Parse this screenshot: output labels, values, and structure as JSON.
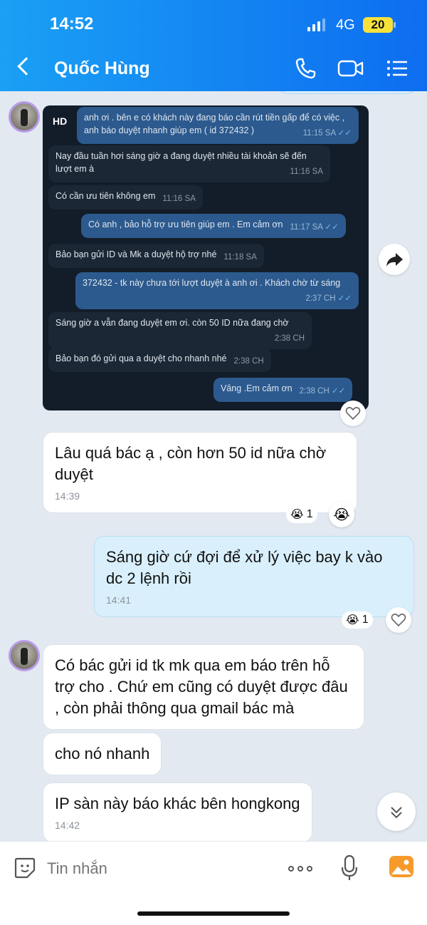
{
  "status_bar": {
    "time": "14:52",
    "network": "4G",
    "battery": "20"
  },
  "header": {
    "contact_name": "Quốc Hùng"
  },
  "image_message": {
    "badge": "HD",
    "messages": [
      {
        "dir": "out",
        "text": "anh ơi . bên e có khách này đang báo cần rút tiền gấp để có việc , anh báo duyệt nhanh giúp em ( id 372432 )",
        "time": "11:15 SA"
      },
      {
        "dir": "in",
        "text": "Nay đầu tuần hơi sáng giờ a đang duyệt nhiều tài khoản sẽ đến lượt em à",
        "time": "11:16 SA"
      },
      {
        "dir": "in",
        "text": "Có cần ưu tiên không em",
        "time": "11:16 SA"
      },
      {
        "dir": "out",
        "text": "Có anh , bảo hỗ trợ ưu tiên giúp em . Em cảm ơn",
        "time": "11:17 SA"
      },
      {
        "dir": "in",
        "text": "Bảo bạn gửi ID và Mk a duyệt hộ trợ nhé",
        "time": "11:18 SA"
      },
      {
        "dir": "out",
        "text": "372432 - tk này chưa tới lượt duyệt à anh ơi . Khách chờ từ sáng",
        "time": "2:37 CH"
      },
      {
        "dir": "in",
        "text": "Sáng giờ a vẫn đang duyệt em ơi. còn 50 ID nữa đang chờ",
        "time": "2:38 CH"
      },
      {
        "dir": "in",
        "text": "Bảo bạn đó gửi qua a duyệt cho nhanh nhé",
        "time": "2:38 CH"
      },
      {
        "dir": "out",
        "text": "Vâng .Em cảm ơn",
        "time": "2:38 CH"
      }
    ]
  },
  "messages": [
    {
      "dir": "in",
      "text": "Lâu quá bác ạ , còn hơn 50 id nữa chờ duyệt",
      "time": "14:39",
      "reaction_count": "1"
    },
    {
      "dir": "out",
      "text": "Sáng giờ cứ đợi để xử lý việc bay k vào dc 2 lệnh rồi",
      "time": "14:41",
      "reaction_count": "1"
    },
    {
      "dir": "in",
      "text": "Có bác gửi id tk mk qua em báo trên hỗ trợ cho . Chứ em cũng có duyệt được đâu , còn phải thông qua gmail bác mà"
    },
    {
      "dir": "in",
      "text": "cho nó nhanh"
    },
    {
      "dir": "in",
      "text": "IP sàn này báo khác bên hongkong",
      "time": "14:42"
    }
  ],
  "input": {
    "placeholder": "Tin nhắn"
  },
  "colors": {
    "header_start": "#1aa0f5",
    "header_end": "#0d6df0",
    "outgoing_bubble": "#d9f0fc",
    "chat_bg": "#e2e9f1"
  }
}
